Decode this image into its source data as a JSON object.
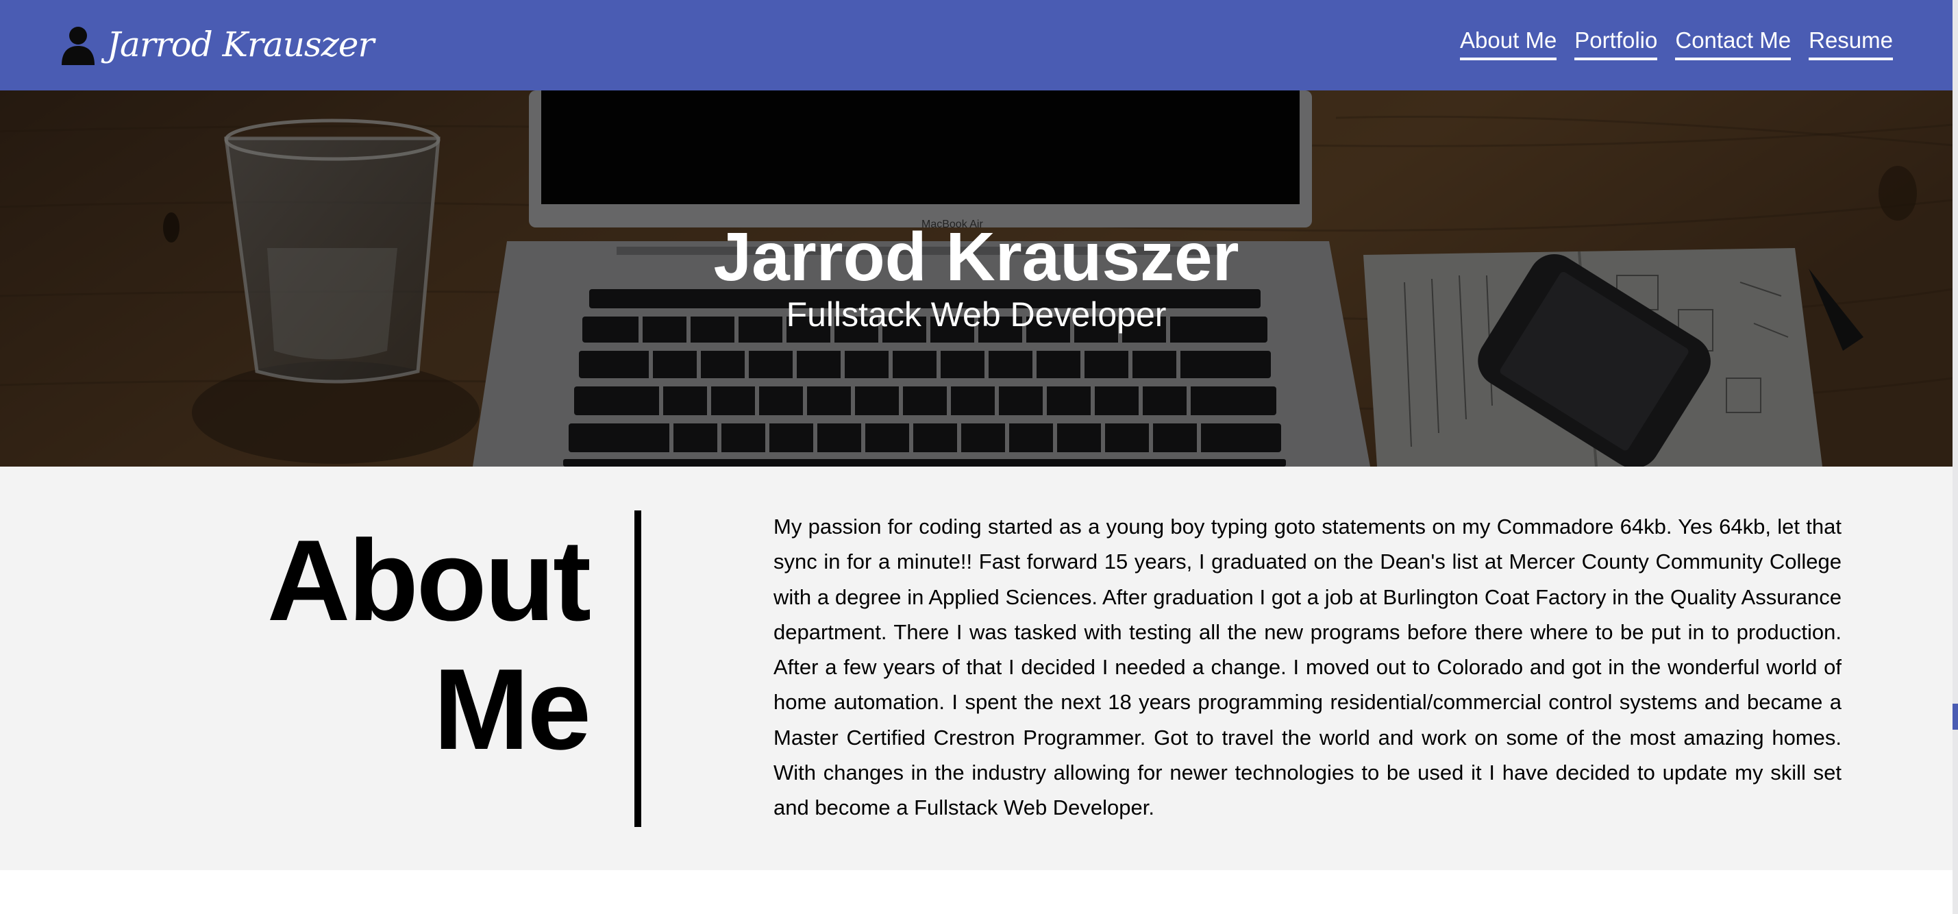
{
  "colors": {
    "nav_background": "#4a5cb3",
    "nav_text": "#ffffff",
    "about_background": "#f3f3f3",
    "hero_text": "#ffffff"
  },
  "nav": {
    "brand_icon": "person-silhouette-icon",
    "brand_name": "Jarrod Krauszer",
    "links": [
      {
        "label": "About Me"
      },
      {
        "label": "Portfolio"
      },
      {
        "label": "Contact Me"
      },
      {
        "label": "Resume"
      }
    ]
  },
  "hero": {
    "title": "Jarrod Krauszer",
    "subtitle": "Fullstack Web Developer",
    "laptop_label": "MacBook Air"
  },
  "about": {
    "heading_line1": "About",
    "heading_line2": "Me",
    "body": "My passion for coding started as a young boy typing goto statements on my Commadore 64kb. Yes 64kb, let that sync in for a minute!! Fast forward 15 years, I graduated on the Dean's list at Mercer County Community College with a degree in Applied Sciences. After graduation I got a job at Burlington Coat Factory in the Quality Assurance department. There I was tasked with testing all the new programs before there where to be put in to production. After a few years of that I decided I needed a change. I moved out to Colorado and got in the wonderful world of home automation. I spent the next 18 years programming residential/commercial control systems and became a Master Certified Crestron Programmer. Got to travel the world and work on some of the most amazing homes. With changes in the industry allowing for newer technologies to be used it I have decided to update my skill set and become a Fullstack Web Developer."
  }
}
